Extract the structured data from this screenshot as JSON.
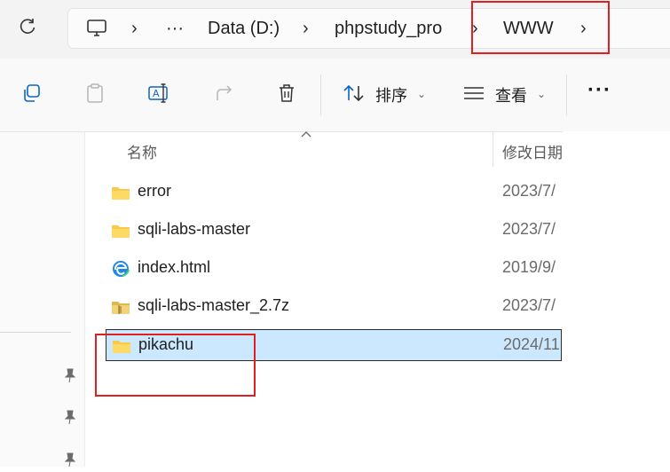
{
  "breadcrumb": {
    "more": "···",
    "items": [
      "Data (D:)",
      "phpstudy_pro",
      "WWW"
    ]
  },
  "toolbar": {
    "sort_label": "排序",
    "view_label": "查看",
    "more": "···"
  },
  "columns": {
    "name": "名称",
    "modified": "修改日期"
  },
  "files": [
    {
      "name": "error",
      "date": "2023/7/",
      "type": "folder"
    },
    {
      "name": "sqli-labs-master",
      "date": "2023/7/",
      "type": "folder"
    },
    {
      "name": "index.html",
      "date": "2019/9/",
      "type": "html"
    },
    {
      "name": "sqli-labs-master_2.7z",
      "date": "2023/7/",
      "type": "archive"
    },
    {
      "name": "pikachu",
      "date": "2024/11",
      "type": "folder",
      "selected": true
    }
  ],
  "colors": {
    "selection": "#cce8ff",
    "highlight_box": "#e02020",
    "folder": "#f8c94a",
    "accent": "#0a64c8"
  }
}
